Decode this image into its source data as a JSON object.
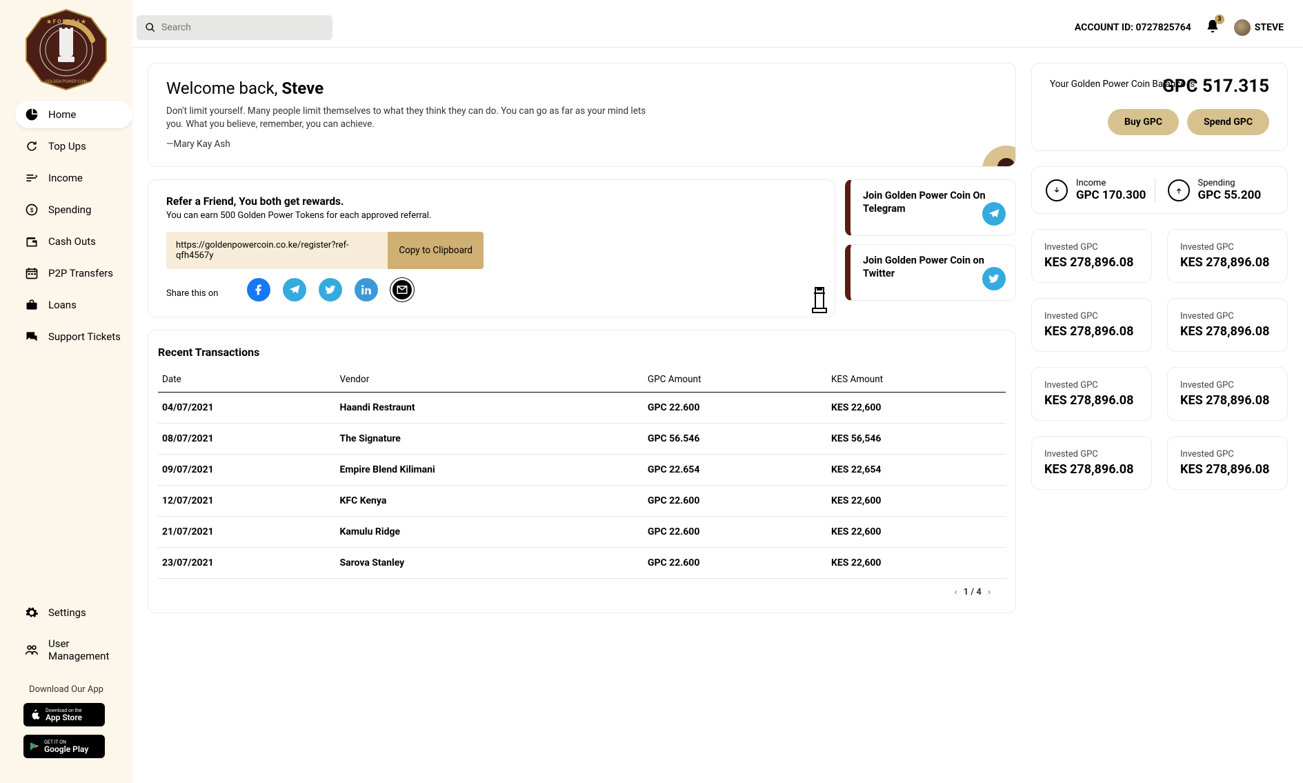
{
  "sidebar": {
    "items": [
      {
        "label": "Home"
      },
      {
        "label": "Top Ups"
      },
      {
        "label": "Income"
      },
      {
        "label": "Spending"
      },
      {
        "label": "Cash Outs"
      },
      {
        "label": "P2P Transfers"
      },
      {
        "label": "Loans"
      },
      {
        "label": "Support Tickets"
      }
    ],
    "bottom": [
      {
        "label": "Settings"
      },
      {
        "label": "User Management"
      }
    ],
    "download_label": "Download Our App",
    "appstore_small": "Download on the",
    "appstore_big": "App Store",
    "play_small": "GET IT ON",
    "play_big": "Google Play"
  },
  "topbar": {
    "search_placeholder": "Search",
    "account_id_label": "ACCOUNT ID: ",
    "account_id": "0727825764",
    "notifications": "3",
    "username": "STEVE"
  },
  "welcome": {
    "greeting": "Welcome back, ",
    "name": "Steve",
    "quote": "Don't limit yourself. Many people limit themselves to what they think they can do. You can go as far as your mind lets you. What you believe, remember, you can achieve.",
    "author": "—Mary Kay Ash"
  },
  "refer": {
    "title": "Refer a Friend, You both get rewards.",
    "subtitle": "You can earn 500 Golden Power Tokens for each approved referral.",
    "url": "https://goldenpowercoin.co.ke/register?ref-qfh4567y",
    "copy": "Copy to Clipboard",
    "share_label": "Share this on"
  },
  "join": {
    "telegram": "Join Golden Power Coin On Telegram",
    "twitter": "Join Golden Power Coin on Twitter"
  },
  "transactions": {
    "title": "Recent Transactions",
    "headers": {
      "date": "Date",
      "vendor": "Vendor",
      "gpc": "GPC Amount",
      "kes": "KES Amount"
    },
    "rows": [
      {
        "date": "04/07/2021",
        "vendor": "Haandi Restraunt",
        "gpc": "GPC 22.600",
        "kes": "KES 22,600"
      },
      {
        "date": "08/07/2021",
        "vendor": "The Signature",
        "gpc": "GPC 56.546",
        "kes": "KES 56,546"
      },
      {
        "date": "09/07/2021",
        "vendor": "Empire Blend Kilimani",
        "gpc": "GPC 22.654",
        "kes": "KES 22,654"
      },
      {
        "date": "12/07/2021",
        "vendor": "KFC Kenya",
        "gpc": "GPC 22.600",
        "kes": "KES 22,600"
      },
      {
        "date": "21/07/2021",
        "vendor": "Kamulu Ridge",
        "gpc": "GPC 22.600",
        "kes": "KES 22,600"
      },
      {
        "date": "23/07/2021",
        "vendor": "Sarova Stanley",
        "gpc": "GPC 22.600",
        "kes": "KES 22,600"
      }
    ],
    "pager": "1 / 4"
  },
  "balance": {
    "label": "Your Golden Power Coin Balance is",
    "value": "GPC 517.315",
    "buy": "Buy GPC",
    "spend": "Spend GPC"
  },
  "io": {
    "income_label": "Income",
    "income_value": "GPC 170.300",
    "spending_label": "Spending",
    "spending_value": "GPC 55.200"
  },
  "invested": [
    {
      "label": "Invested GPC",
      "value": "KES 278,896.08"
    },
    {
      "label": "Invested GPC",
      "value": "KES 278,896.08"
    },
    {
      "label": "Invested GPC",
      "value": "KES 278,896.08"
    },
    {
      "label": "Invested GPC",
      "value": "KES 278,896.08"
    },
    {
      "label": "Invested GPC",
      "value": "KES 278,896.08"
    },
    {
      "label": "Invested GPC",
      "value": "KES 278,896.08"
    },
    {
      "label": "Invested GPC",
      "value": "KES 278,896.08"
    },
    {
      "label": "Invested GPC",
      "value": "KES 278,896.08"
    }
  ]
}
